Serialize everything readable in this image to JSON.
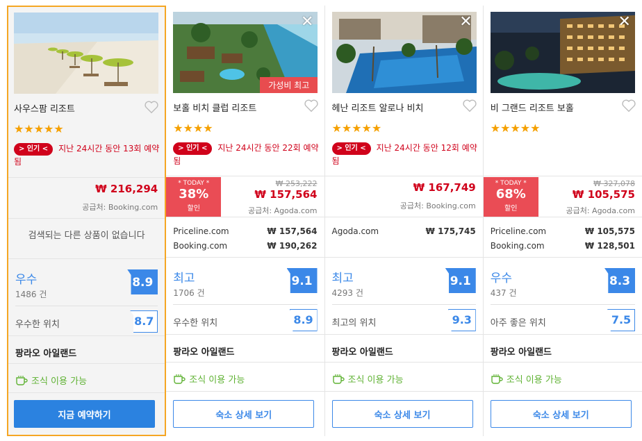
{
  "hotels": [
    {
      "name": "사우스팜 리조트",
      "stars": "★★★★★",
      "promo_badge": "> 인기 <",
      "promo_text": "지난 24시간 동안 13회 예약됨",
      "price": "₩ 216,294",
      "supplier": "공급처: Booking.com",
      "no_others": "검색되는 다른 상품이 없습니다",
      "rating_label": "우수",
      "rating_count": "1486 건",
      "rating_score": "8.9",
      "location_label": "우수한 위치",
      "location_score": "8.7",
      "area": "팡라오 아일랜드",
      "breakfast": "조식 이용 가능",
      "button": "지금 예약하기"
    },
    {
      "name": "보홀 비치 클럽 리조트",
      "stars": "★★★★",
      "ribbon": "가성비 최고",
      "promo_badge": "> 인기 <",
      "promo_text": "지난 24시간 동안 22회 예약됨",
      "today_label": "* TODAY *",
      "today_pct": "38%",
      "today_sub": "할인",
      "price_old": "₩ 253,222",
      "price": "₩ 157,564",
      "supplier": "공급처: Agoda.com",
      "others": [
        {
          "site": "Priceline.com",
          "price": "₩ 157,564"
        },
        {
          "site": "Booking.com",
          "price": "₩ 190,262"
        }
      ],
      "rating_label": "최고",
      "rating_count": "1706 건",
      "rating_score": "9.1",
      "location_label": "우수한 위치",
      "location_score": "8.9",
      "area": "팡라오 아일랜드",
      "breakfast": "조식 이용 가능",
      "button": "숙소 상세 보기"
    },
    {
      "name": "헤난 리조트 알로나 비치",
      "stars": "★★★★★",
      "promo_badge": "> 인기 <",
      "promo_text": "지난 24시간 동안 12회 예약됨",
      "price": "₩ 167,749",
      "supplier": "공급처: Booking.com",
      "others": [
        {
          "site": "Agoda.com",
          "price": "₩ 175,745"
        }
      ],
      "rating_label": "최고",
      "rating_count": "4293 건",
      "rating_score": "9.1",
      "location_label": "최고의 위치",
      "location_score": "9.3",
      "area": "팡라오 아일랜드",
      "breakfast": "조식 이용 가능",
      "button": "숙소 상세 보기"
    },
    {
      "name": "비 그랜드 리조트 보홀",
      "stars": "★★★★★",
      "today_label": "* TODAY *",
      "today_pct": "68%",
      "today_sub": "할인",
      "price_old": "₩ 327,078",
      "price": "₩ 105,575",
      "supplier": "공급처: Agoda.com",
      "others": [
        {
          "site": "Priceline.com",
          "price": "₩ 105,575"
        },
        {
          "site": "Booking.com",
          "price": "₩ 128,501"
        }
      ],
      "rating_label": "우수",
      "rating_count": "437 건",
      "rating_score": "8.3",
      "location_label": "아주 좋은 위치",
      "location_score": "7.5",
      "area": "팡라오 아일랜드",
      "breakfast": "조식 이용 가능",
      "button": "숙소 상세 보기"
    }
  ],
  "icons": {
    "close": "close-icon",
    "heart": "heart-icon",
    "cup": "coffee-cup-icon"
  },
  "colors": {
    "accent_blue": "#3b88e8",
    "price_red": "#d0021b",
    "highlight_border": "#f5a623",
    "breakfast_green": "#5fb233",
    "discount_red": "#ea4c55"
  }
}
